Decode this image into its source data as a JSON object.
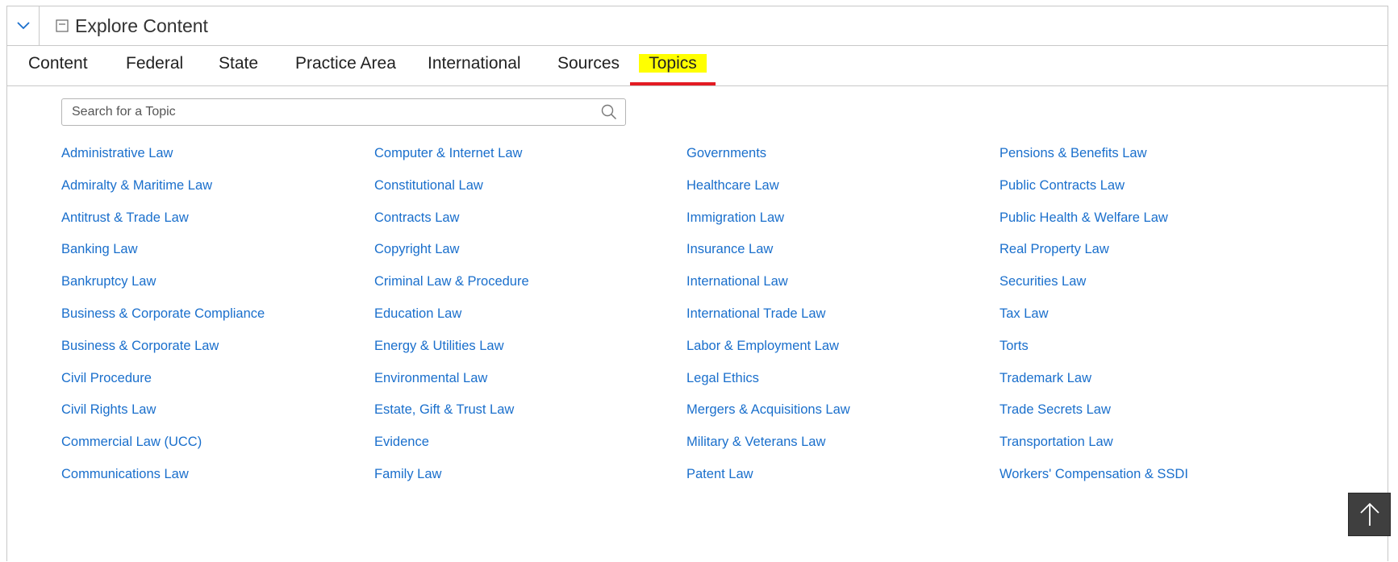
{
  "header": {
    "title": "Explore Content",
    "toggle_icon": "chevron-down-icon",
    "title_icon": "collapse-box-icon"
  },
  "tabs": [
    {
      "label": "Content"
    },
    {
      "label": "Federal"
    },
    {
      "label": "State"
    },
    {
      "label": "Practice Area"
    },
    {
      "label": "International"
    },
    {
      "label": "Sources"
    },
    {
      "label": "Topics",
      "active": true
    }
  ],
  "search": {
    "placeholder": "Search for a Topic",
    "value": ""
  },
  "topics": [
    [
      "Administrative Law",
      "Admiralty & Maritime Law",
      "Antitrust & Trade Law",
      "Banking Law",
      "Bankruptcy Law",
      "Business & Corporate Compliance",
      "Business & Corporate Law",
      "Civil Procedure",
      "Civil Rights Law",
      "Commercial Law (UCC)",
      "Communications Law"
    ],
    [
      "Computer & Internet Law",
      "Constitutional Law",
      "Contracts Law",
      "Copyright Law",
      "Criminal Law & Procedure",
      "Education Law",
      "Energy & Utilities Law",
      "Environmental Law",
      "Estate, Gift & Trust Law",
      "Evidence",
      "Family Law"
    ],
    [
      "Governments",
      "Healthcare Law",
      "Immigration Law",
      "Insurance Law",
      "International Law",
      "International Trade Law",
      "Labor & Employment Law",
      "Legal Ethics",
      "Mergers & Acquisitions Law",
      "Military & Veterans Law",
      "Patent Law"
    ],
    [
      "Pensions & Benefits Law",
      "Public Contracts Law",
      "Public Health & Welfare Law",
      "Real Property Law",
      "Securities Law",
      "Tax Law",
      "Torts",
      "Trademark Law",
      "Trade Secrets Law",
      "Transportation Law",
      "Workers' Compensation & SSDI"
    ]
  ],
  "colors": {
    "link": "#1a6fcc",
    "active_tab_underline": "#e31b23",
    "active_tab_highlight": "#ffff00",
    "back_to_top_bg": "#3f3f3f"
  },
  "back_to_top": {
    "icon": "arrow-up-icon"
  }
}
